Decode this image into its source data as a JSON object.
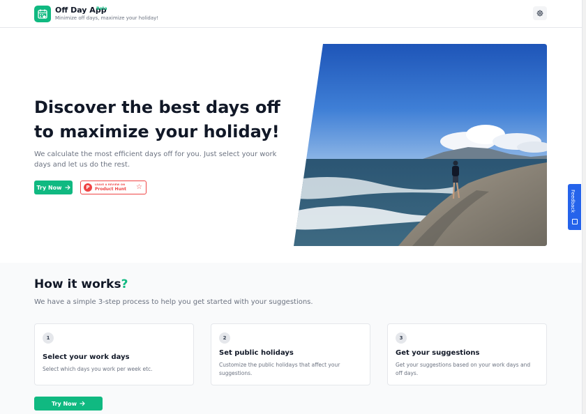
{
  "header": {
    "app_title": "Off Day App",
    "beta_label": "Beta",
    "tagline": "Minimize off days, maximize your holiday!",
    "logo_icon": "calendar-icon",
    "settings_icon": "gear-icon"
  },
  "hero": {
    "title": "Discover the best days off to maximize your holiday!",
    "subtitle": "We calculate the most efficient days off for you. Just select your work days and let us do the rest.",
    "try_now_label": "Try Now",
    "product_hunt": {
      "small_text": "LEAVE A REVIEW ON",
      "big_text": "Product Hunt",
      "logo_letter": "P"
    }
  },
  "how_it_works": {
    "title": "How it works",
    "title_accent": "?",
    "subtitle": "We have a simple 3-step process to help you get started with your suggestions.",
    "steps": [
      {
        "number": "1",
        "title": "Select your work days",
        "description": "Select which days you work per week etc."
      },
      {
        "number": "2",
        "title": "Set public holidays",
        "description": "Customize the public holidays that affect your suggestions."
      },
      {
        "number": "3",
        "title": "Get your suggestions",
        "description": "Get your suggestions based on your work days and off days."
      }
    ],
    "try_now_label": "Try Now"
  },
  "feedback": {
    "label": "Feedback"
  },
  "colors": {
    "accent": "#10b981",
    "feedback": "#2563eb",
    "product_hunt": "#ef4444"
  }
}
